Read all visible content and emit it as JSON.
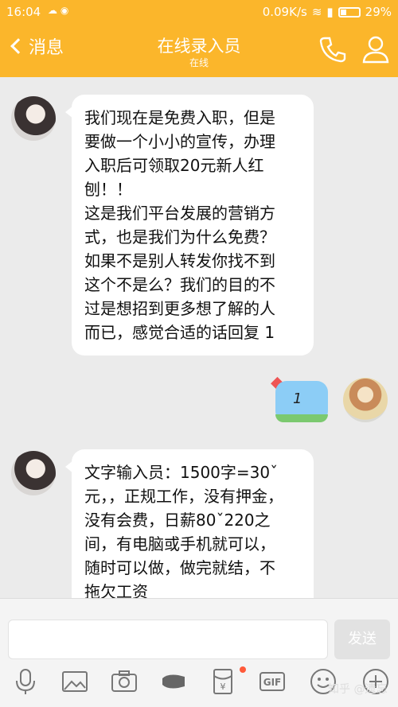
{
  "status_bar": {
    "time": "16:04",
    "network_speed": "0.09K/s",
    "battery": "29%",
    "accent": "#fbb62b"
  },
  "header": {
    "back_label": "消息",
    "title": "在线录入员",
    "subtitle": "在线",
    "icons": [
      "back-chevron-icon",
      "phone-icon",
      "profile-icon"
    ]
  },
  "messages": [
    {
      "from": "other",
      "text": "我们现在是免费入职，但是\n要做一个小小的宣传，办理\n入职后可领取20元新人红\n刨！！\n这是我们平台发展的营销方\n式，也是我们为什么免费？\n如果不是别人转发你找不到\n这个不是么？我们的目的不\n过是想招到更多想了解的人\n而已，感觉合适的话回复 1"
    },
    {
      "from": "me",
      "text": "1"
    },
    {
      "from": "other",
      "text": "文字输入员：1500字=30ˇ\n元，，正规工作，没有押金，\n没有会费，日薪80ˇ220之\n间，有电脑或手机就可以，\n随时可以做，做完就结，不\n拖欠工资"
    }
  ],
  "composer": {
    "send_label": "发送",
    "toolbar_icons": [
      "microphone-icon",
      "image-icon",
      "camera-icon",
      "video-call-icon",
      "red-packet-icon",
      "gif-icon",
      "emoji-icon",
      "add-icon"
    ],
    "gif_label": "GIF",
    "redpacket_label": "¥"
  },
  "watermark": "知乎 @遗忘"
}
